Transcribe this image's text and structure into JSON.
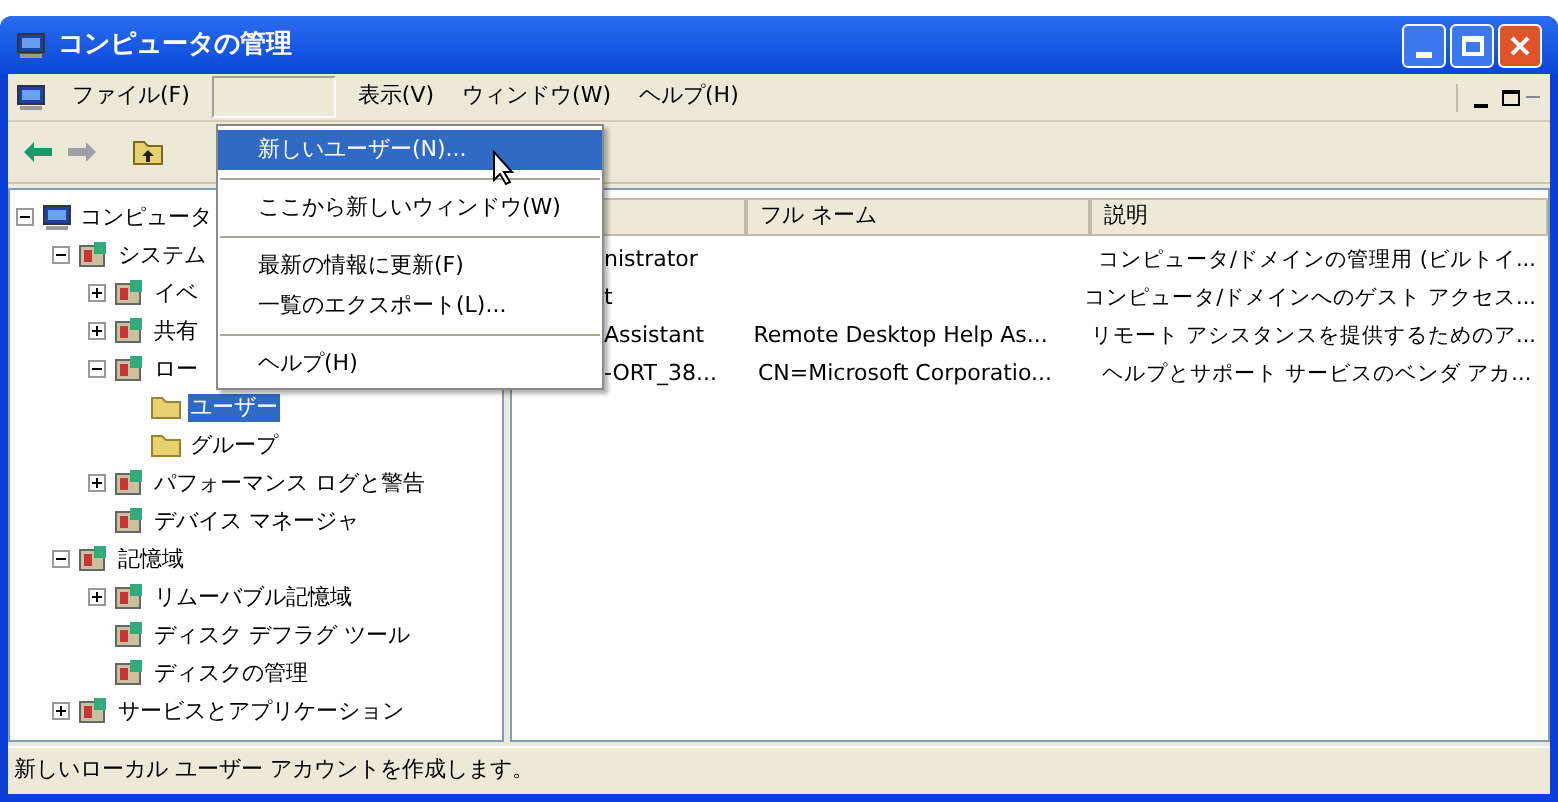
{
  "window": {
    "title": "コンピュータの管理"
  },
  "menu_bar": [
    {
      "label": "ファイル(F)",
      "selected": false
    },
    {
      "selected": true
    },
    {
      "label": "表示(V)",
      "selected": false
    },
    {
      "label": "ウィンドウ(W)",
      "selected": false
    },
    {
      "label": "ヘルプ(H)",
      "selected": false
    }
  ],
  "toolbar": [
    {
      "kind": "back",
      "disabled": false
    },
    {
      "kind": "forward",
      "disabled": true
    },
    {
      "kind": "up",
      "disabled": false
    }
  ],
  "tree": [
    {
      "label": "コンピュータ",
      "expanded": true,
      "children": [
        {
          "label": "システム",
          "expanded": true,
          "children": [
            {
              "label": "イベ",
              "expanded": false
            },
            {
              "label": "共有",
              "expanded": false
            },
            {
              "label": "ロー",
              "expanded": true,
              "children": [
                {
                  "label": "ユーザー",
                  "selected": true
                },
                {
                  "label": "グループ",
                  "selected": false
                }
              ]
            },
            {
              "label": "パフォーマンス ログと警告",
              "expanded": false
            },
            {
              "label": "デバイス マネージャ"
            }
          ]
        },
        {
          "label": "記憶域",
          "expanded": true,
          "children": [
            {
              "label": "リムーバブル記憶域",
              "expanded": false
            },
            {
              "label": "ディスク デフラグ ツール"
            },
            {
              "label": "ディスクの管理"
            }
          ]
        },
        {
          "label": "サービスとアプリケーション",
          "expanded": false
        }
      ]
    }
  ],
  "list": {
    "columns": [
      "フル ネーム",
      "説明"
    ],
    "rows": [
      {
        "name": "nistrator",
        "full_name": "",
        "description": "コンピュータ/ドメインの管理用 (ビルトイ..."
      },
      {
        "name": "t",
        "full_name": "",
        "description": "コンピュータ/ドメインへのゲスト アクセス..."
      },
      {
        "name": "Assistant",
        "full_name": "Remote Desktop Help As...",
        "description": "リモート アシスタンスを提供するためのア..."
      },
      {
        "name": "-ORT_38...",
        "full_name": "CN=Microsoft Corporatio...",
        "description": "ヘルプとサポート サービスのベンダ アカ..."
      }
    ]
  },
  "menu": [
    {
      "kind": "item",
      "label": "新しいユーザー(N)...",
      "selected": true
    },
    {
      "kind": "separator"
    },
    {
      "kind": "item",
      "label": "ここから新しいウィンドウ(W)",
      "selected": false
    },
    {
      "kind": "separator"
    },
    {
      "kind": "item",
      "label": "最新の情報に更新(F)",
      "selected": false
    },
    {
      "kind": "item",
      "label": "一覧のエクスポート(L)...",
      "selected": false
    },
    {
      "kind": "separator"
    },
    {
      "kind": "item",
      "label": "ヘルプ(H)",
      "selected": false
    }
  ],
  "status_bar": "新しいローカル ユーザー アカウントを作成します。"
}
